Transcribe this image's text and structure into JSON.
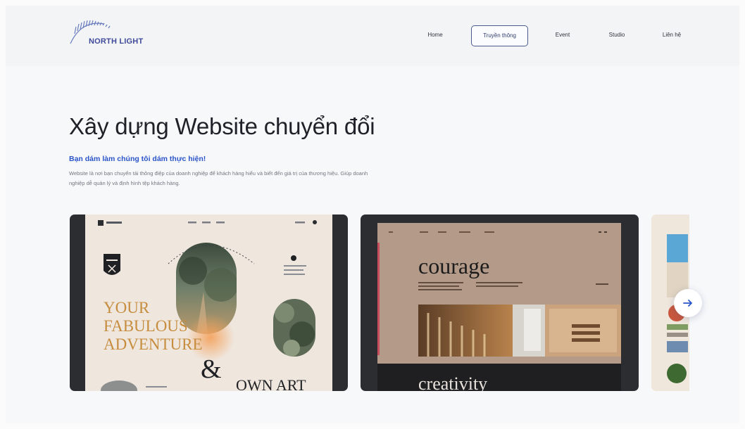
{
  "brand": {
    "name": "NORTH LIGHT"
  },
  "nav": {
    "items": [
      {
        "label": "Home"
      },
      {
        "label": "Truyền thông",
        "active": true
      },
      {
        "label": "Event"
      },
      {
        "label": "Studio"
      },
      {
        "label": "Liên hệ"
      }
    ]
  },
  "hero": {
    "title": "Xây dựng Website chuyển đổi",
    "subtitle": "Bạn dám làm chúng tôi dám thực hiện!",
    "description": "Website là nơi bạn chuyển tải thông điệp của doanh nghiệp để khách hàng hiểu và biết đến giá trị của thương hiệu. Giúp doanh nghiệp dễ quản lý và định hình tệp khách hàng."
  },
  "cards": {
    "card1": {
      "line1": "YOUR",
      "line2": "FABULOUS",
      "line3": "ADVENTURE",
      "amp": "&",
      "line4": "OWN ART"
    },
    "card2": {
      "headline": "courage",
      "footer_word": "creativity"
    }
  },
  "colors": {
    "accent": "#2a55c9",
    "active_border": "#4a5b8c",
    "logo": "#3f4a9a",
    "card_dark": "#2b2d31",
    "card1_bg": "#efe6de",
    "card2_bg": "#b49a88"
  },
  "icons": {
    "next": "arrow-right-icon"
  }
}
